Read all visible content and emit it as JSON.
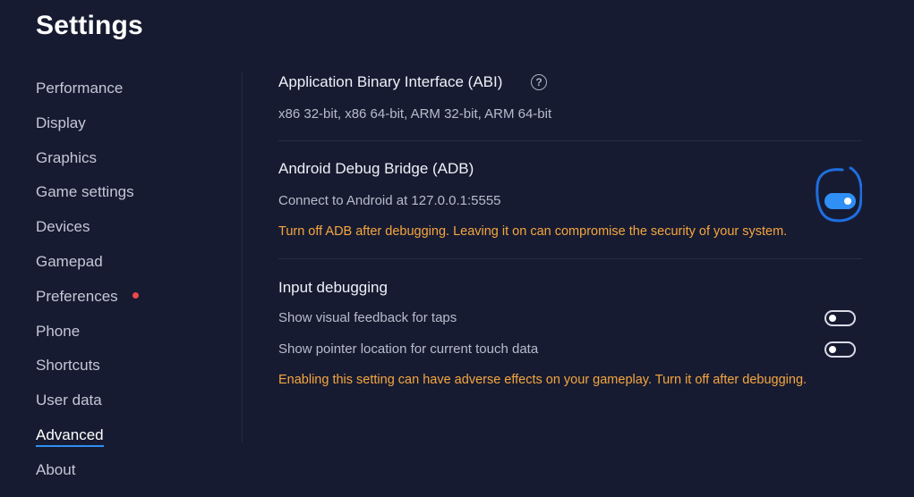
{
  "window": {
    "title": "Settings"
  },
  "sidebar": {
    "items": [
      {
        "label": "Performance",
        "active": false,
        "dot": false
      },
      {
        "label": "Display",
        "active": false,
        "dot": false
      },
      {
        "label": "Graphics",
        "active": false,
        "dot": false
      },
      {
        "label": "Game settings",
        "active": false,
        "dot": false
      },
      {
        "label": "Devices",
        "active": false,
        "dot": false
      },
      {
        "label": "Gamepad",
        "active": false,
        "dot": false
      },
      {
        "label": "Preferences",
        "active": false,
        "dot": true
      },
      {
        "label": "Phone",
        "active": false,
        "dot": false
      },
      {
        "label": "Shortcuts",
        "active": false,
        "dot": false
      },
      {
        "label": "User data",
        "active": false,
        "dot": false
      },
      {
        "label": "Advanced",
        "active": true,
        "dot": false
      },
      {
        "label": "About",
        "active": false,
        "dot": false
      }
    ]
  },
  "abi": {
    "title": "Application Binary Interface (ABI)",
    "help_icon": "question-circle-icon",
    "value": "x86 32-bit, x86 64-bit, ARM 32-bit, ARM 64-bit"
  },
  "adb": {
    "title": "Android Debug Bridge (ADB)",
    "connect_label": "Connect to Android at 127.0.0.1:5555",
    "toggle_on": true,
    "warning": "Turn off ADB after debugging. Leaving it on can compromise the security of your system."
  },
  "input_debugging": {
    "title": "Input debugging",
    "options": [
      {
        "label": "Show visual feedback for taps",
        "toggle_on": false
      },
      {
        "label": "Show pointer location for current touch data",
        "toggle_on": false
      }
    ],
    "warning": "Enabling this setting can have adverse effects on your gameplay. Turn it off after debugging."
  },
  "colors": {
    "background": "#171b31",
    "accent": "#2f8ff5",
    "warning": "#f4a640",
    "notification_dot": "#f0474a"
  }
}
